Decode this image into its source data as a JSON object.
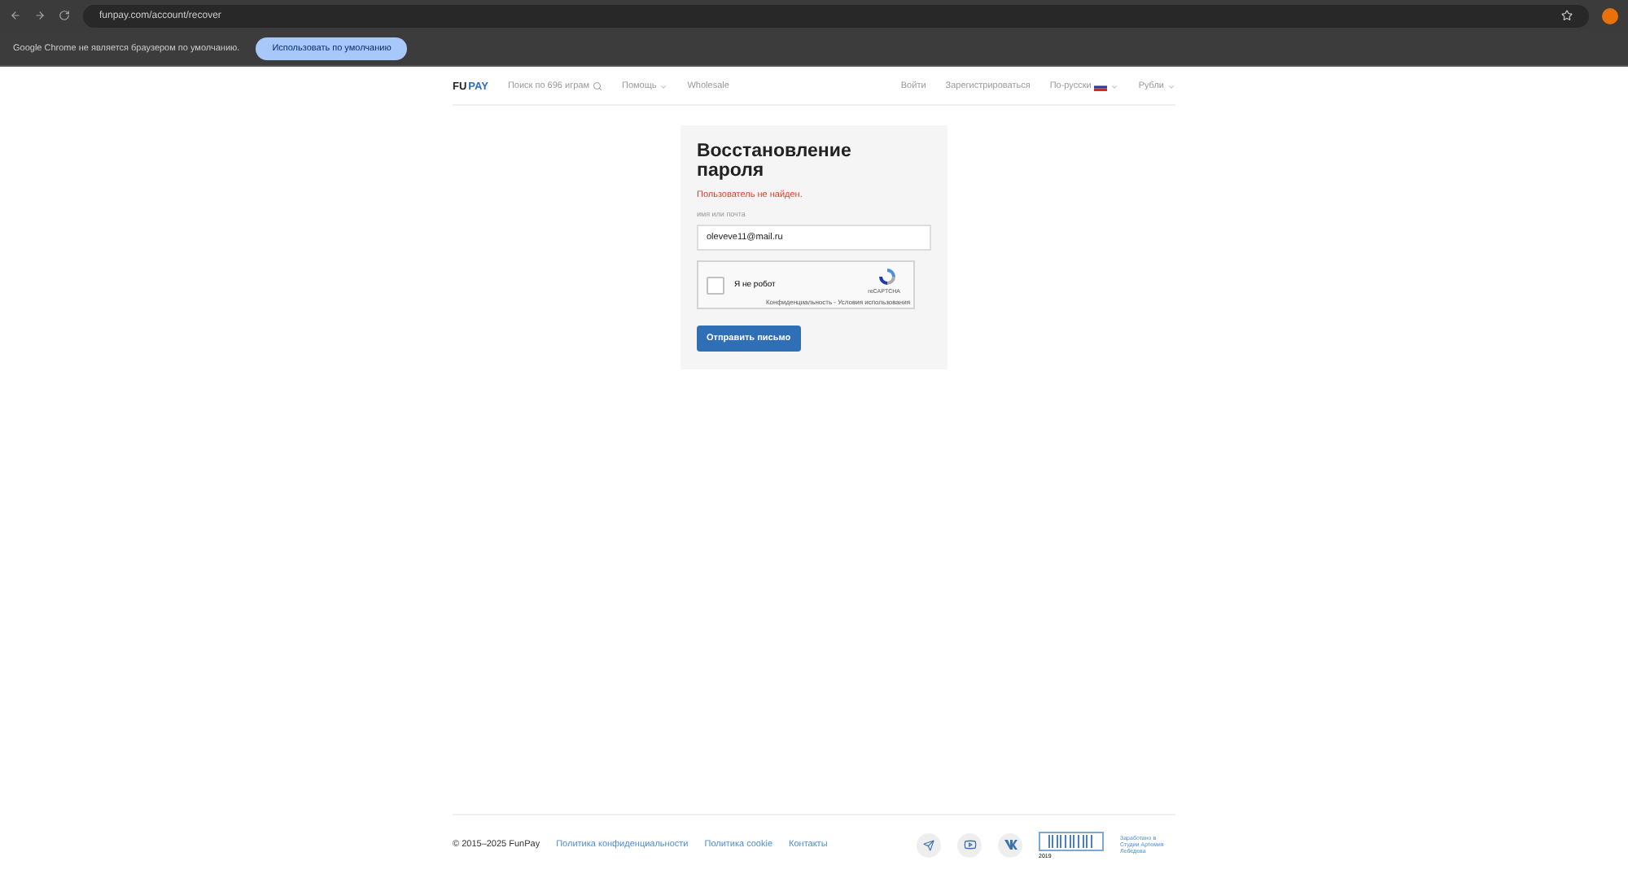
{
  "browser": {
    "url": "funpay.com/account/recover",
    "infobar_text": "Google Chrome не является браузером по умолчанию.",
    "infobar_button": "Использовать по умолчанию"
  },
  "header": {
    "logo_left": "FU",
    "logo_right": "PAY",
    "search_placeholder": "Поиск по 696 играм",
    "nav": [
      "Помощь",
      "Wholesale"
    ],
    "right": [
      {
        "label": "Войти",
        "kind": "link"
      },
      {
        "label": "Зарегистрироваться",
        "kind": "link"
      },
      {
        "label": "По-русски",
        "kind": "language"
      },
      {
        "label": "Рубли",
        "kind": "dropdown"
      }
    ]
  },
  "form": {
    "title": "Восстановление пароля",
    "error": "Пользователь не найден.",
    "field_label": "имя или почта",
    "field_value": "oleveve11@mail.ru",
    "captcha": {
      "label": "Я не робот",
      "checked": false,
      "brand": "reCAPTCHA",
      "links": "Конфиденциальность - Условия использования"
    },
    "submit": "Отправить письмо"
  },
  "footer": {
    "copyright": "© 2015–2025 FunPay",
    "links": [
      "Политика конфиденциальности",
      "Политика cookie",
      "Контакты"
    ],
    "badge_year": "2019",
    "credit": "Заработано в Студии Артемия Лебедева"
  }
}
